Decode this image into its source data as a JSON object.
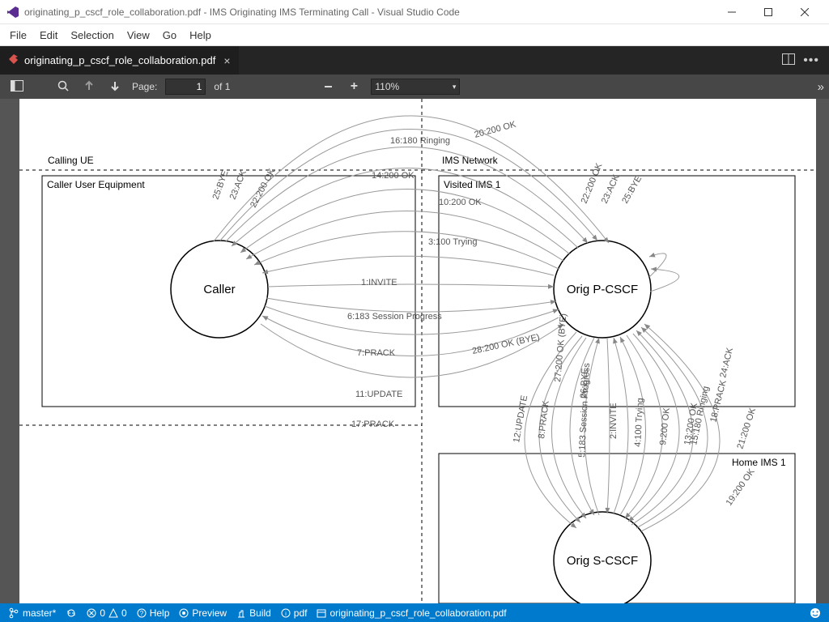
{
  "window": {
    "title": "originating_p_cscf_role_collaboration.pdf - IMS Originating IMS Terminating Call - Visual Studio Code"
  },
  "menu": {
    "file": "File",
    "edit": "Edit",
    "selection": "Selection",
    "view": "View",
    "go": "Go",
    "help": "Help"
  },
  "tab": {
    "filename": "originating_p_cscf_role_collaboration.pdf"
  },
  "pdf_toolbar": {
    "page_label": "Page:",
    "page_input": "1",
    "of_label": "of 1",
    "zoom": "110%"
  },
  "diagram": {
    "groups": {
      "calling_ue": "Calling UE",
      "ims_network": "IMS Network"
    },
    "boxes": {
      "caller_ue": "Caller User Equipment",
      "visited_ims1": "Visited IMS 1",
      "home_ims1": "Home IMS 1"
    },
    "nodes": {
      "caller": "Caller",
      "orig_p_cscf": "Orig P-CSCF",
      "orig_s_cscf": "Orig S-CSCF"
    },
    "edges": {
      "e1": "1:INVITE",
      "e2": "2:INVITE",
      "e3": "3:100 Trying",
      "e4": "4:100 Trying",
      "e5": "5:183 Session Progress",
      "e6": "6:183 Session Progress",
      "e7": "7:PRACK",
      "e8": "8:PRACK",
      "e9": "9:200 OK",
      "e10": "10:200 OK",
      "e11": "11:UPDATE",
      "e12": "12:UPDATE",
      "e13": "13:200 OK",
      "e14": "14:200 OK",
      "e15": "15:180 Ringing",
      "e16": "16:180 Ringing",
      "e17": "17:PRACK",
      "e18": "18:PRACK",
      "e19": "19:200 OK",
      "e20": "20:200 OK",
      "e21": "21:200 OK",
      "e22": "22:200 OK",
      "e23a": "23:ACK",
      "e23b": "23:ACK",
      "e24": "24:ACK",
      "e25a": "25:BYE",
      "e25b": "25:BYE",
      "e26": "26:BYE",
      "e27": "27:200 OK (BYE)",
      "e28": "28:200 OK (BYE)"
    }
  },
  "status": {
    "branch": "master*",
    "errors": "0",
    "warnings": "0",
    "help": "Help",
    "preview": "Preview",
    "build": "Build",
    "pdf": "pdf",
    "filepath": "originating_p_cscf_role_collaboration.pdf"
  }
}
